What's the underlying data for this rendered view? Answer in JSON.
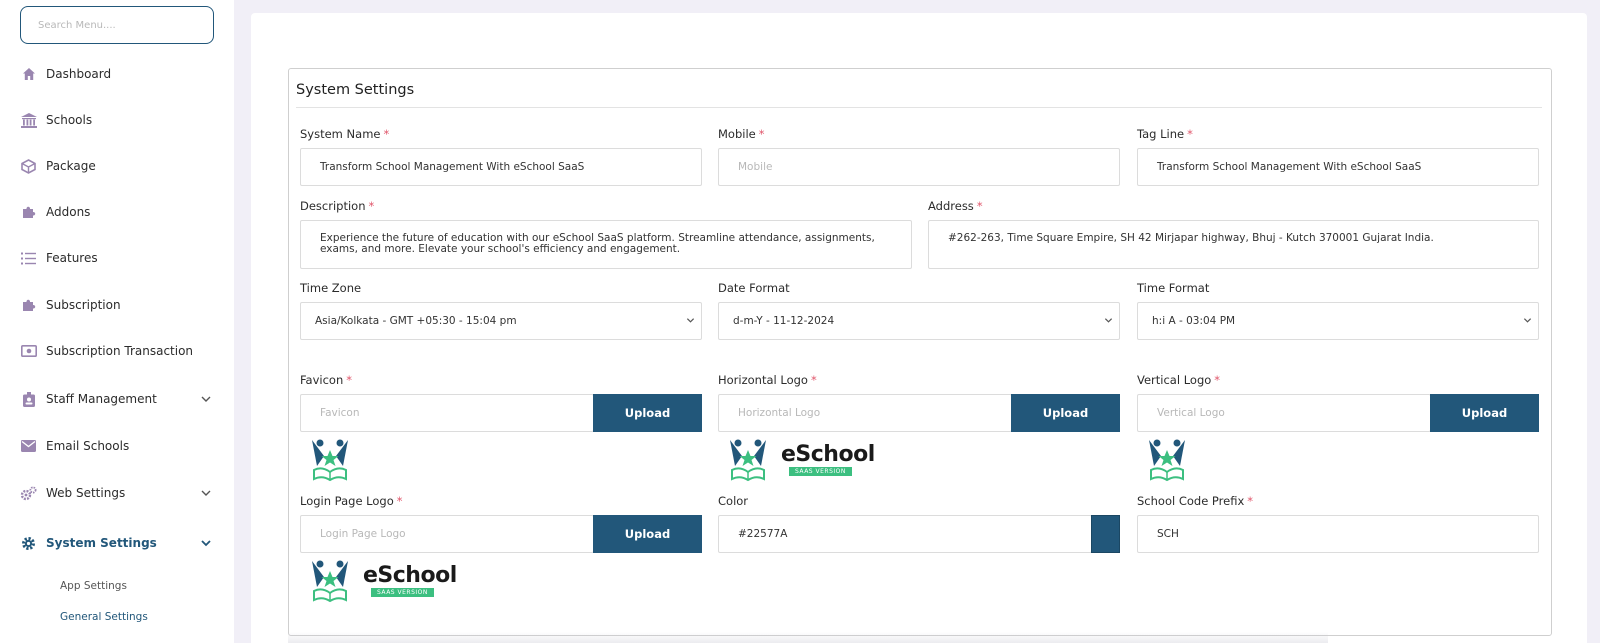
{
  "sidebar": {
    "search_placeholder": "Search Menu....",
    "items": [
      {
        "label": "Dashboard",
        "icon": "home-icon"
      },
      {
        "label": "Schools",
        "icon": "bank-icon"
      },
      {
        "label": "Package",
        "icon": "box-icon"
      },
      {
        "label": "Addons",
        "icon": "puzzle-icon"
      },
      {
        "label": "Features",
        "icon": "list-icon"
      },
      {
        "label": "Subscription",
        "icon": "puzzle-icon"
      },
      {
        "label": "Subscription Transaction",
        "icon": "money-icon"
      },
      {
        "label": "Staff Management",
        "icon": "badge-icon"
      },
      {
        "label": "Email Schools",
        "icon": "envelope-icon"
      },
      {
        "label": "Web Settings",
        "icon": "gears-icon"
      },
      {
        "label": "System Settings",
        "icon": "gear-icon"
      }
    ],
    "subitems": [
      {
        "label": "App Settings"
      },
      {
        "label": "General Settings"
      }
    ]
  },
  "form": {
    "title": "System Settings",
    "system_name": {
      "label": "System Name",
      "value": "Transform School Management With eSchool SaaS"
    },
    "mobile": {
      "label": "Mobile",
      "placeholder": "Mobile"
    },
    "tag_line": {
      "label": "Tag Line",
      "value": "Transform School Management With eSchool SaaS"
    },
    "description": {
      "label": "Description",
      "value": "Experience the future of education with our eSchool SaaS platform. Streamline attendance, assignments, exams, and more. Elevate your school's efficiency and engagement."
    },
    "address": {
      "label": "Address",
      "value": "#262-263, Time Square Empire, SH 42 Mirjapar highway, Bhuj - Kutch 370001 Gujarat India."
    },
    "time_zone": {
      "label": "Time Zone",
      "value": "Asia/Kolkata - GMT +05:30 - 15:04 pm"
    },
    "date_format": {
      "label": "Date Format",
      "value": "d-m-Y - 11-12-2024"
    },
    "time_format": {
      "label": "Time Format",
      "value": "h:i A - 03:04 PM"
    },
    "favicon": {
      "label": "Favicon",
      "placeholder": "Favicon"
    },
    "horizontal_logo": {
      "label": "Horizontal Logo",
      "placeholder": "Horizontal Logo"
    },
    "vertical_logo": {
      "label": "Vertical Logo",
      "placeholder": "Vertical Logo"
    },
    "login_page_logo": {
      "label": "Login Page Logo",
      "placeholder": "Login Page Logo"
    },
    "color": {
      "label": "Color",
      "value": "#22577A"
    },
    "school_code_prefix": {
      "label": "School Code Prefix",
      "value": "SCH"
    },
    "upload_label": "Upload",
    "required_mark": "*"
  },
  "logo": {
    "word": "eSchool",
    "badge": "SAAS VERSION"
  },
  "colors": {
    "accent": "#22577a",
    "required": "#e0556a",
    "logo_green": "#3cbf80",
    "sidebar_icon": "#9a86b0"
  }
}
